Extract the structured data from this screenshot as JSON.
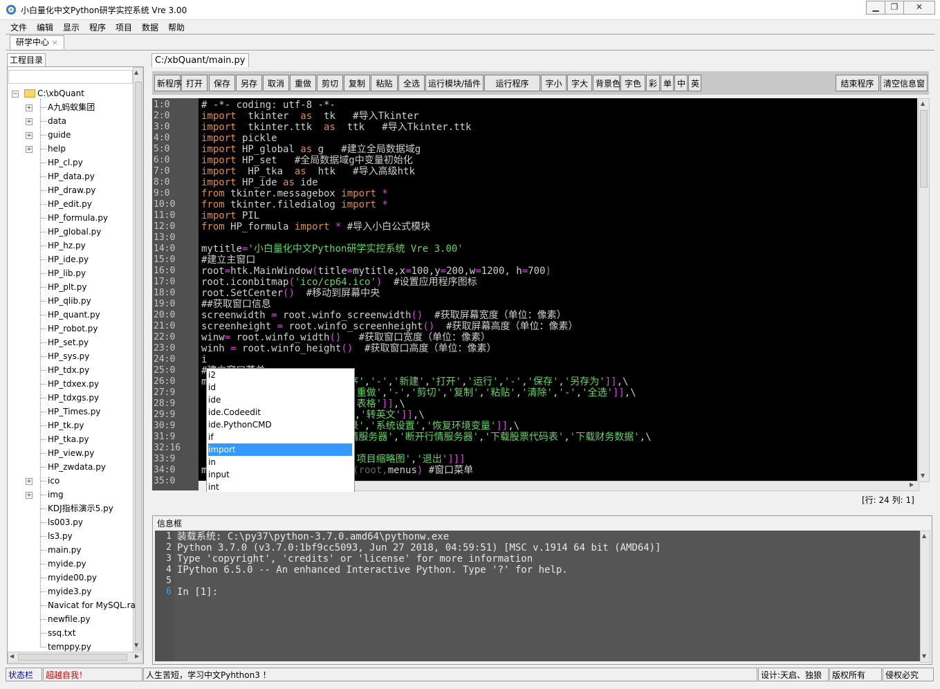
{
  "window": {
    "title": "小白量化中文Python研学实控系统 Vre 3.00",
    "min_label": "▭",
    "max_label": "▢",
    "close_label": "✕"
  },
  "menu": [
    "文件",
    "编辑",
    "显示",
    "程序",
    "项目",
    "数据",
    "帮助"
  ],
  "tabs": {
    "main_tab": "研学中心",
    "main_tab_close": "×",
    "project_tab": "工程目录",
    "file_tab": "C:/xbQuant/main.py"
  },
  "tree": {
    "root": "C:\\xbQuant",
    "items": [
      {
        "label": "A九蚂蚁集团",
        "folder": true
      },
      {
        "label": "data",
        "folder": true
      },
      {
        "label": "guide",
        "folder": true
      },
      {
        "label": "help",
        "folder": true
      },
      {
        "label": "HP_cl.py",
        "folder": false
      },
      {
        "label": "HP_data.py",
        "folder": false
      },
      {
        "label": "HP_draw.py",
        "folder": false
      },
      {
        "label": "HP_edit.py",
        "folder": false
      },
      {
        "label": "HP_formula.py",
        "folder": false
      },
      {
        "label": "HP_global.py",
        "folder": false
      },
      {
        "label": "HP_hz.py",
        "folder": false
      },
      {
        "label": "HP_ide.py",
        "folder": false
      },
      {
        "label": "HP_lib.py",
        "folder": false
      },
      {
        "label": "HP_plt.py",
        "folder": false
      },
      {
        "label": "HP_qlib.py",
        "folder": false
      },
      {
        "label": "HP_quant.py",
        "folder": false
      },
      {
        "label": "HP_robot.py",
        "folder": false
      },
      {
        "label": "HP_set.py",
        "folder": false
      },
      {
        "label": "HP_sys.py",
        "folder": false
      },
      {
        "label": "HP_tdx.py",
        "folder": false
      },
      {
        "label": "HP_tdxex.py",
        "folder": false
      },
      {
        "label": "HP_tdxgs.py",
        "folder": false
      },
      {
        "label": "HP_Times.py",
        "folder": false
      },
      {
        "label": "HP_tk.py",
        "folder": false
      },
      {
        "label": "HP_tka.py",
        "folder": false
      },
      {
        "label": "HP_view.py",
        "folder": false
      },
      {
        "label": "HP_zwdata.py",
        "folder": false
      },
      {
        "label": "ico",
        "folder": true
      },
      {
        "label": "img",
        "folder": true
      },
      {
        "label": "KDJ指标演示5.py",
        "folder": false
      },
      {
        "label": "ls003.py",
        "folder": false
      },
      {
        "label": "ls3.py",
        "folder": false
      },
      {
        "label": "main.py",
        "folder": false
      },
      {
        "label": "myide.py",
        "folder": false
      },
      {
        "label": "myide00.py",
        "folder": false
      },
      {
        "label": "myide3.py",
        "folder": false
      },
      {
        "label": "Navicat for MySQL.ra",
        "folder": false
      },
      {
        "label": "newfile.py",
        "folder": false
      },
      {
        "label": "ssq.txt",
        "folder": false
      },
      {
        "label": "temppy.py",
        "folder": false
      }
    ]
  },
  "toolbar": [
    "新程序",
    "打开",
    "保存",
    "另存",
    "取消",
    "重做",
    "剪切",
    "复制",
    "粘贴",
    "全选",
    "运行模块/插件",
    "运行程序",
    "字小",
    "字大",
    "背景色",
    "字色",
    "彩",
    "单",
    "中",
    "英"
  ],
  "toolbar_right": [
    "结束程序",
    "清空信息窗"
  ],
  "editor": {
    "line_numbers": [
      "1:0",
      "2:0",
      "3:0",
      "4:0",
      "5:0",
      "6:0",
      "7:0",
      "8:0",
      "9:0",
      "10:0",
      "11:0",
      "12:0",
      "13:0",
      "14:0",
      "15:0",
      "16:0",
      "17:0",
      "18:0",
      "19:0",
      "20:0",
      "21:0",
      "22:0",
      "23:0",
      "24:0",
      "25:0",
      "26:0",
      "27:9",
      "28:9",
      "29:9",
      "30:9",
      "31:9",
      "32:16",
      "33:9",
      "34:0",
      "35:0"
    ],
    "cursor_position": "[行: 24   列: 1]"
  },
  "autocomplete": [
    "i2",
    "id",
    "ide",
    "ide.Codeedit",
    "ide.PythonCMD",
    "if",
    "import",
    "in",
    "input",
    "int"
  ],
  "autocomplete_selected": 6,
  "info": {
    "label": "信息框",
    "line_numbers": [
      "1",
      "2",
      "3",
      "4",
      "5",
      "6"
    ],
    "lines": [
      "装载系统: C:\\py37\\python-3.7.0.amd64\\pythonw.exe",
      "Python 3.7.0 (v3.7.0:1bf9cc5093, Jun 27 2018, 04:59:51) [MSC v.1914 64 bit (AMD64)]",
      "Type 'copyright', 'credits' or 'license' for more information",
      "IPython 6.5.0 -- An enhanced Interactive Python. Type '?' for help.",
      "",
      "In [1]:"
    ]
  },
  "status": {
    "label": "状态栏",
    "slogan": "超越自我！",
    "message": "人生苦短，学习中文Pyhthon3 ！",
    "design": "设计:天启、独狼",
    "copyright": "版权所有",
    "rights": "侵权必究"
  },
  "colors": {
    "keyword": "#e09040",
    "string": "#5fd75f",
    "operator": "#e040e0",
    "selection": "#3399ff",
    "slogan": "#e00000",
    "status_label": "#0000c0"
  }
}
